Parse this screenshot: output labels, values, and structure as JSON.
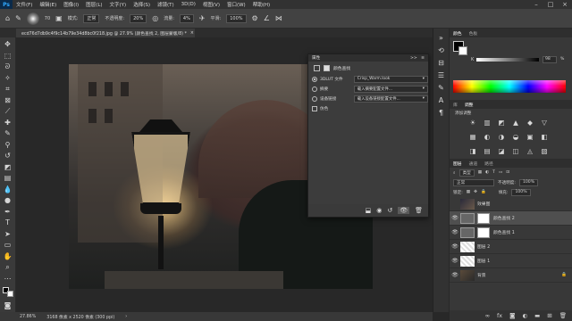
{
  "menubar": {
    "logo": "Ps",
    "items": [
      "文件(F)",
      "编辑(E)",
      "图像(I)",
      "图层(L)",
      "文字(Y)",
      "选择(S)",
      "滤镜(T)",
      "3D(D)",
      "视图(V)",
      "窗口(W)",
      "帮助(H)"
    ],
    "controls": [
      "–",
      "□",
      "×"
    ]
  },
  "options": {
    "size": "70",
    "mode_label": "模式:",
    "mode_value": "正常",
    "opacity_label": "不透明度:",
    "opacity_value": "20%",
    "flow_label": "流量:",
    "flow_value": "4%",
    "smooth_label": "平滑:",
    "smooth_value": "100%"
  },
  "document": {
    "tab_title": "ecd76d7db9c4f9c14b79e34d8bc0f218.jpg @ 27.9% (颜色查找 2, 图层蒙版/8) *",
    "tab_close": "×"
  },
  "status": {
    "zoom": "27.86%",
    "info": "3168 像素 x 2520 像素 (300 ppi)"
  },
  "properties_panel": {
    "panel_title": "属性",
    "panel_menu": ">>",
    "panel_close": "≡",
    "subtitle": "颜色查找",
    "rows": [
      {
        "label": "3DLUT 文件",
        "value": "Crisp_Warm.look",
        "selected": true
      },
      {
        "label": "摘要",
        "value": "载入摘要配置文件...",
        "selected": false
      },
      {
        "label": "设备链接",
        "value": "载入设备链接配置文件...",
        "selected": false
      }
    ],
    "dither_label": "仿色"
  },
  "color_panel": {
    "tabs": [
      "颜色",
      "色板"
    ],
    "k_label": "K",
    "k_value": "98",
    "k_unit": "%"
  },
  "adjust_panel": {
    "tabs": [
      "库",
      "调整"
    ],
    "hint": "添加调整",
    "icons": [
      "☀",
      "▥",
      "◩",
      "▲",
      "◆",
      "▽",
      "▦",
      "◐",
      "◑",
      "◒",
      "▣",
      "◧",
      "◨",
      "▤",
      "◪",
      "◫",
      "◬",
      "▧"
    ]
  },
  "layers_panel": {
    "tabs": [
      "图层",
      "通道",
      "路径"
    ],
    "kind_label": "类型",
    "blend_mode": "正常",
    "opacity_label": "不透明度:",
    "opacity_value": "100%",
    "lock_label": "锁定:",
    "fill_label": "填充:",
    "fill_value": "100%",
    "layers": [
      {
        "name": "效果图",
        "visible": false,
        "type": "image",
        "selected": false
      },
      {
        "name": "颜色查找 2",
        "visible": true,
        "type": "adjust",
        "selected": true
      },
      {
        "name": "颜色查找 1",
        "visible": true,
        "type": "adjust",
        "selected": false
      },
      {
        "name": "图层 2",
        "visible": true,
        "type": "blank",
        "selected": false
      },
      {
        "name": "图层 1",
        "visible": true,
        "type": "blank",
        "selected": false
      },
      {
        "name": "背景",
        "visible": true,
        "type": "image",
        "selected": false
      }
    ]
  }
}
